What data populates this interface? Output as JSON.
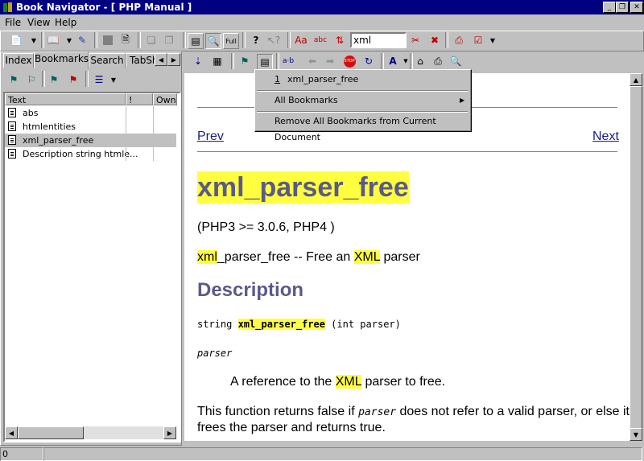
{
  "window": {
    "title": "Book Navigator - [ PHP Manual ]"
  },
  "menubar": {
    "file": "File",
    "view": "View",
    "help": "Help"
  },
  "toolbar": {
    "search_value": "xml"
  },
  "tabs": [
    "Index",
    "Bookmarks",
    "Search",
    "TabSh"
  ],
  "list": {
    "columns": [
      "Text",
      "!",
      "Owne"
    ],
    "rows": [
      "abs",
      "htmlentities",
      "xml_parser_free",
      "Description string htmle..."
    ],
    "selected_index": 2
  },
  "dropdown": {
    "item1_num": "1",
    "item1_label": "xml_parser_free",
    "all_bookmarks": "All Bookmarks",
    "remove_all": "Remove All Bookmarks from Current Document"
  },
  "doc": {
    "prev": "Prev",
    "next": "Next",
    "title": "xml_parser_free",
    "version": "(PHP3 >= 3.0.6, PHP4 )",
    "desc_a": "xml",
    "desc_b": "_parser_free -- Free an ",
    "desc_c": "XML",
    "desc_d": " parser",
    "description_heading": "Description",
    "sig_type": "string ",
    "sig_func": "xml_parser_free",
    "sig_args": " (int parser)",
    "param": "parser",
    "param_desc_a": "A reference to the ",
    "param_desc_b": "XML",
    "param_desc_c": " parser to free.",
    "ret_a": "This function returns false if ",
    "ret_b": "parser",
    "ret_c": " does not refer to a valid parser, or else it",
    "ret_d": "frees the parser and returns true."
  },
  "status": {
    "value": "0"
  },
  "colors": {
    "highlight": "#ffff40",
    "title_bar": "#000080",
    "heading": "#5a5a8a"
  }
}
